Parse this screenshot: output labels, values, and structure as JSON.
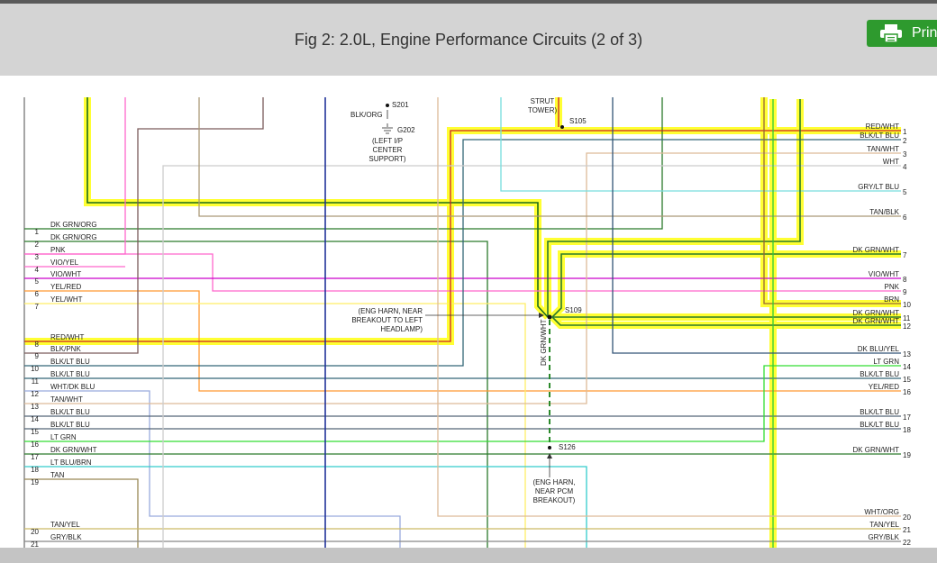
{
  "header": {
    "title": "Fig 2: 2.0L, Engine Performance Circuits (2 of 3)",
    "print_label": "Prin",
    "print_icon": "printer-icon",
    "accent_color": "#2e9a2e"
  },
  "diagram": {
    "highlight_color": "#ffff33",
    "left_pins": [
      {
        "num": "1",
        "label": "DK GRN/ORG"
      },
      {
        "num": "2",
        "label": "DK GRN/ORG"
      },
      {
        "num": "3",
        "label": "PNK"
      },
      {
        "num": "4",
        "label": "VIO/YEL"
      },
      {
        "num": "5",
        "label": "VIO/WHT"
      },
      {
        "num": "6",
        "label": "YEL/RED"
      },
      {
        "num": "7",
        "label": "YEL/WHT"
      },
      {
        "num": "8",
        "label": "RED/WHT"
      },
      {
        "num": "9",
        "label": "BLK/PNK"
      },
      {
        "num": "10",
        "label": "BLK/LT BLU"
      },
      {
        "num": "11",
        "label": "BLK/LT BLU"
      },
      {
        "num": "12",
        "label": "WHT/DK BLU"
      },
      {
        "num": "13",
        "label": "TAN/WHT"
      },
      {
        "num": "14",
        "label": "BLK/LT BLU"
      },
      {
        "num": "15",
        "label": "BLK/LT BLU"
      },
      {
        "num": "16",
        "label": "LT GRN"
      },
      {
        "num": "17",
        "label": "DK GRN/WHT"
      },
      {
        "num": "18",
        "label": "LT BLU/BRN"
      },
      {
        "num": "19",
        "label": "TAN"
      },
      {
        "num": "20",
        "label": "TAN/YEL"
      },
      {
        "num": "21",
        "label": "GRY/BLK"
      }
    ],
    "right_pins": [
      {
        "num": "1",
        "label": "RED/WHT"
      },
      {
        "num": "2",
        "label": "BLK/LT BLU"
      },
      {
        "num": "3",
        "label": "TAN/WHT"
      },
      {
        "num": "4",
        "label": "WHT"
      },
      {
        "num": "5",
        "label": "GRY/LT BLU"
      },
      {
        "num": "6",
        "label": "TAN/BLK"
      },
      {
        "num": "7",
        "label": "DK GRN/WHT"
      },
      {
        "num": "8",
        "label": "VIO/WHT"
      },
      {
        "num": "9",
        "label": "PNK"
      },
      {
        "num": "10",
        "label": "BRN"
      },
      {
        "num": "11",
        "label": "DK GRN/WHT"
      },
      {
        "num": "12",
        "label": "DK GRN/WHT"
      },
      {
        "num": "13",
        "label": "DK BLU/YEL"
      },
      {
        "num": "14",
        "label": "LT GRN"
      },
      {
        "num": "15",
        "label": "BLK/LT BLU"
      },
      {
        "num": "16",
        "label": "YEL/RED"
      },
      {
        "num": "17",
        "label": "BLK/LT BLU"
      },
      {
        "num": "18",
        "label": "BLK/LT BLU"
      },
      {
        "num": "19",
        "label": "DK GRN/WHT"
      },
      {
        "num": "20",
        "label": "WHT/ORG"
      },
      {
        "num": "21",
        "label": "TAN/YEL"
      },
      {
        "num": "22",
        "label": "GRY/BLK"
      }
    ],
    "splices": {
      "s201": "S201",
      "s105": "S105",
      "s109": "S109",
      "s126": "S126",
      "g202": "G202"
    },
    "notes": {
      "blk_org": "BLK/ORG",
      "g202_line1": "(LEFT I/P",
      "g202_line2": "CENTER",
      "g202_line3": "SUPPORT)",
      "strut_line1": "STRUT",
      "strut_line2": "TOWER)",
      "eng_line1": "(ENG HARN, NEAR",
      "eng_line2": "BREAKOUT TO LEFT",
      "eng_line3": "HEADLAMP)",
      "pcm_line1": "(ENG HARN,",
      "pcm_line2": "NEAR PCM",
      "pcm_line3": "BREAKOUT)",
      "vertical_wire": "DK GRN/WHT"
    }
  }
}
